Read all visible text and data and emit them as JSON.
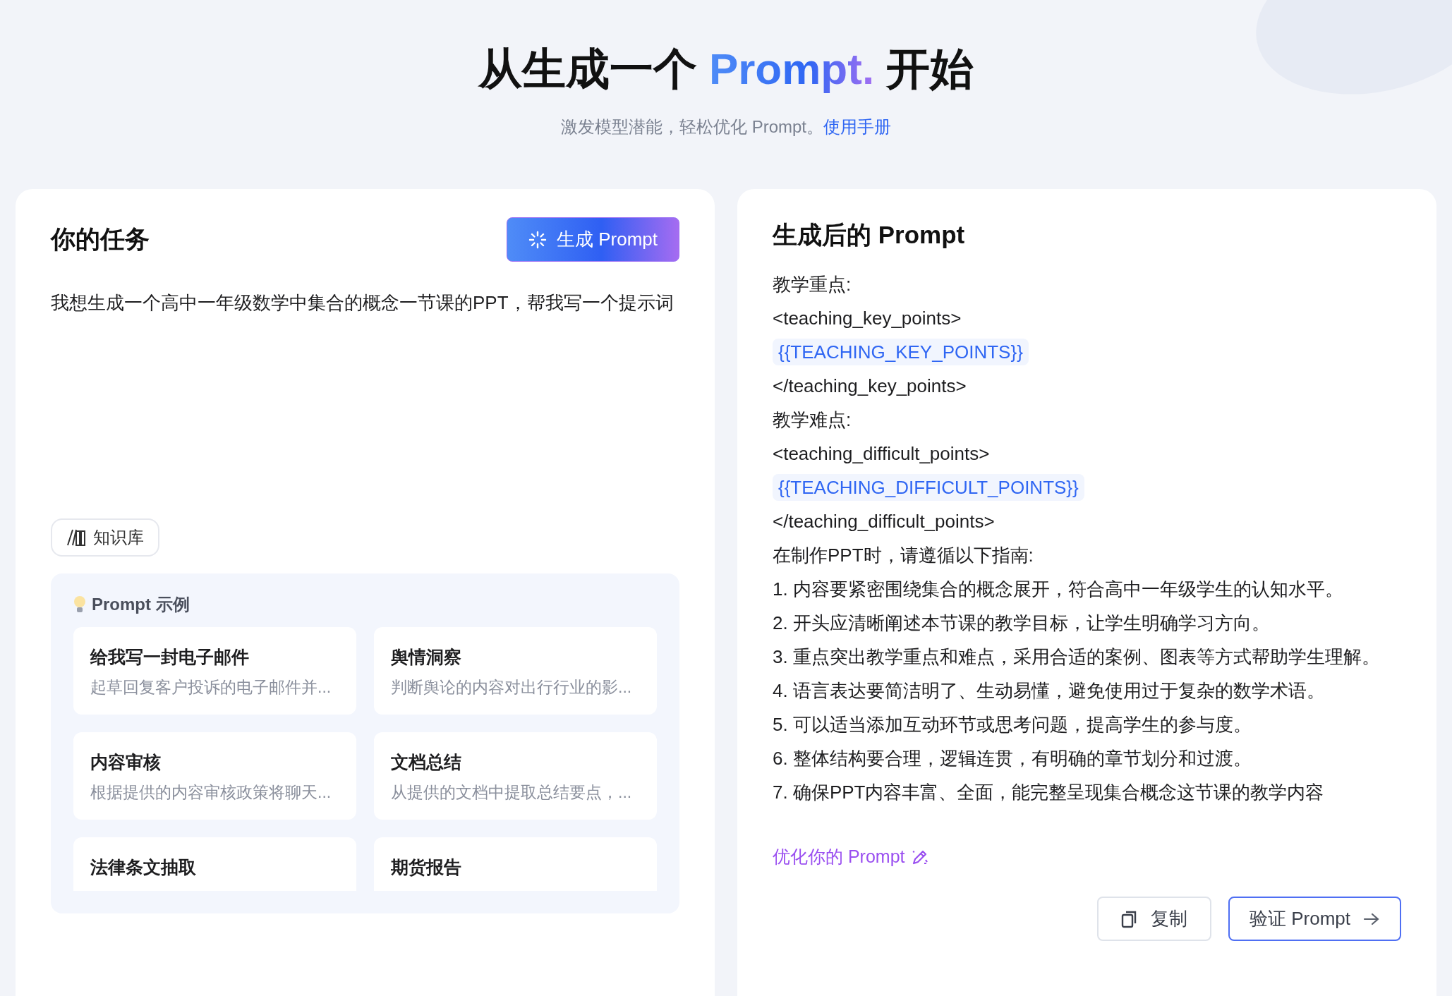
{
  "header": {
    "title_before": "从生成一个 ",
    "title_highlight": "Prompt.",
    "title_after": " 开始",
    "subtitle": "激发模型潜能，轻松优化 Prompt。",
    "subtitle_link": "使用手册"
  },
  "task_panel": {
    "title": "你的任务",
    "generate_button": "生成 Prompt",
    "task_text": "我想生成一个高中一年级数学中集合的概念一节课的PPT，帮我写一个提示词",
    "knowledge_button": "知识库",
    "examples": {
      "title": "Prompt 示例",
      "items": [
        {
          "title": "给我写一封电子邮件",
          "description": "起草回复客户投诉的电子邮件并..."
        },
        {
          "title": "舆情洞察",
          "description": "判断舆论的内容对出行行业的影..."
        },
        {
          "title": "内容审核",
          "description": "根据提供的内容审核政策将聊天..."
        },
        {
          "title": "文档总结",
          "description": "从提供的文档中提取总结要点，..."
        },
        {
          "title": "法律条文抽取"
        },
        {
          "title": "期货报告"
        }
      ]
    }
  },
  "result_panel": {
    "title": "生成后的 Prompt",
    "lines": [
      {
        "kind": "text",
        "text": "教学重点:"
      },
      {
        "kind": "text",
        "text": "<teaching_key_points>"
      },
      {
        "kind": "variable",
        "text": "{{TEACHING_KEY_POINTS}}"
      },
      {
        "kind": "text",
        "text": "</teaching_key_points>"
      },
      {
        "kind": "text",
        "text": "教学难点:"
      },
      {
        "kind": "text",
        "text": "<teaching_difficult_points>"
      },
      {
        "kind": "variable",
        "text": "{{TEACHING_DIFFICULT_POINTS}}"
      },
      {
        "kind": "text",
        "text": "</teaching_difficult_points>"
      },
      {
        "kind": "text",
        "text": "在制作PPT时，请遵循以下指南:"
      },
      {
        "kind": "text",
        "text": "1. 内容要紧密围绕集合的概念展开，符合高中一年级学生的认知水平。"
      },
      {
        "kind": "text",
        "text": "2. 开头应清晰阐述本节课的教学目标，让学生明确学习方向。"
      },
      {
        "kind": "text",
        "text": "3. 重点突出教学重点和难点，采用合适的案例、图表等方式帮助学生理解。"
      },
      {
        "kind": "text",
        "text": "4. 语言表达要简洁明了、生动易懂，避免使用过于复杂的数学术语。"
      },
      {
        "kind": "text",
        "text": "5. 可以适当添加互动环节或思考问题，提高学生的参与度。"
      },
      {
        "kind": "text",
        "text": "6. 整体结构要合理，逻辑连贯，有明确的章节划分和过渡。"
      },
      {
        "kind": "text",
        "text": "7. 确保PPT内容丰富、全面，能完整呈现集合概念这节课的教学内容"
      }
    ],
    "optimize_link": "优化你的 Prompt",
    "copy_button": "复制",
    "verify_button": "验证 Prompt"
  }
}
